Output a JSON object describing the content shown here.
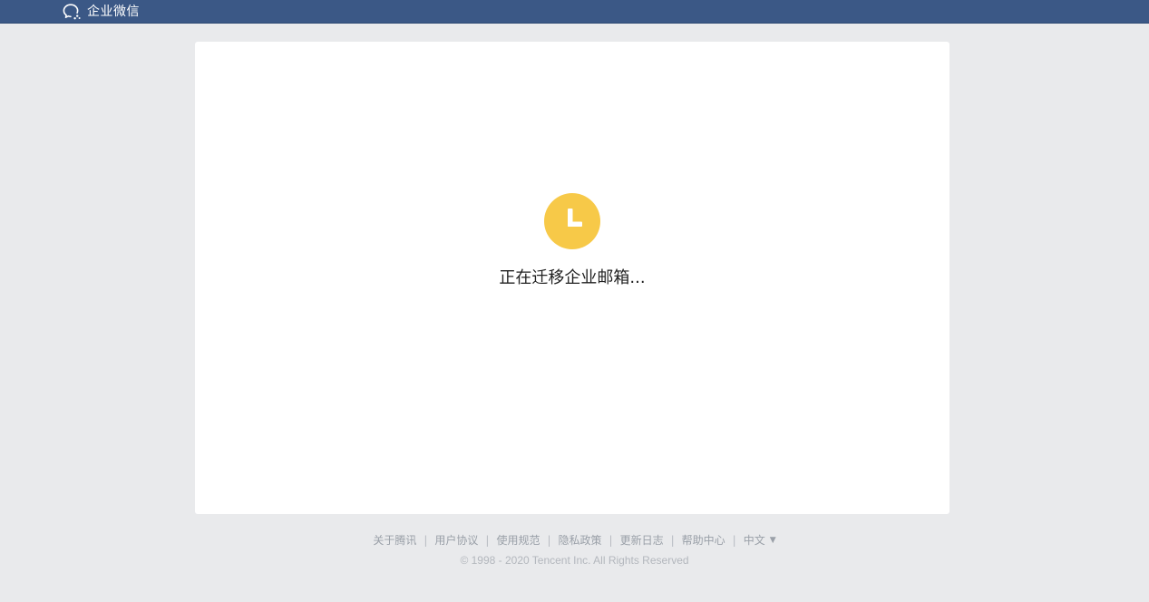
{
  "header": {
    "brand_name": "企业微信",
    "brand_icon": "wework-chat-icon",
    "background_color": "#3b5886"
  },
  "main": {
    "status_icon": "clock-icon",
    "status_icon_color": "#f7c948",
    "status_text": "正在迁移企业邮箱..."
  },
  "footer": {
    "links": [
      {
        "label": "关于腾讯"
      },
      {
        "label": "用户协议"
      },
      {
        "label": "使用规范"
      },
      {
        "label": "隐私政策"
      },
      {
        "label": "更新日志"
      },
      {
        "label": "帮助中心"
      }
    ],
    "separator": "|",
    "language": {
      "selected": "中文",
      "caret": "▼"
    },
    "copyright": "© 1998 - 2020 Tencent Inc. All Rights Reserved"
  }
}
